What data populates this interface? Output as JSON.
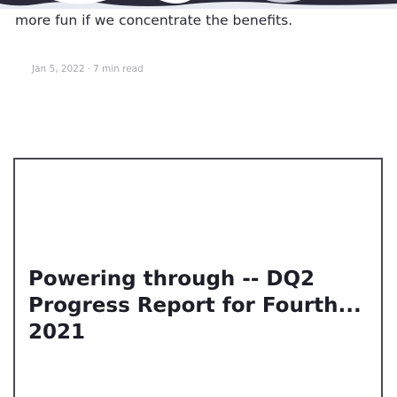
{
  "previous_post": {
    "excerpt": "more fun if we concentrate the benefits.",
    "date": "Jan 5, 2022",
    "separator": "·",
    "read_time": "7 min read"
  },
  "next_post": {
    "title": "Powering through -- DQ2 Progress Report for Fourth... 2021"
  },
  "colors": {
    "top_image_dark": "#2a2a3a",
    "top_image_light": "#e8eaf2",
    "thumbnail_border": "#4a4a55",
    "meta_text": "#a8a8b0"
  }
}
